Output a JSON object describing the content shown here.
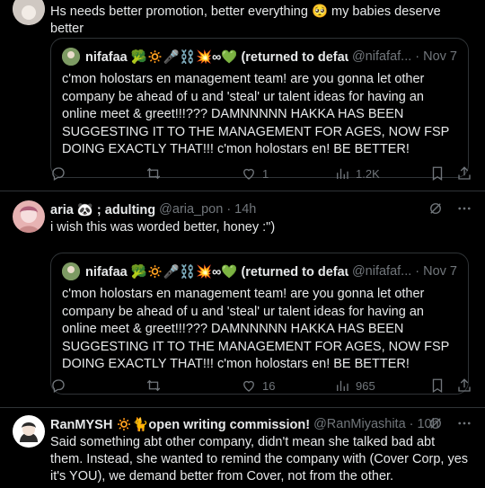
{
  "tweet1": {
    "text": "Hs needs better promotion, better everything 🥺 my babies deserve better",
    "quote": {
      "name": "nifafaa 🥦🔅🎤⛓️💥∞💚 (returned to defau...",
      "handle": "@nifafaf...",
      "dot": "·",
      "time": "Nov 7",
      "text": "c'mon holostars en management team! are you gonna let other company be ahead of u and 'steal' ur talent ideas for having an online meet & greet!!!??? DAMNNNNN HAKKA HAS BEEN SUGGESTING IT TO THE MANAGEMENT FOR AGES, NOW FSP DOING EXACTLY THAT!!! c'mon holostars en! BE BETTER!"
    },
    "actions": {
      "reply": "",
      "retweet": "",
      "like": "1",
      "views": "1.2K"
    }
  },
  "tweet2": {
    "name": "aria 🐼 ; adulting",
    "handle": "@aria_pon",
    "dot": "·",
    "time": "14h",
    "text": "i wish this was worded better, honey :\")",
    "quote": {
      "name": "nifafaa 🥦🔅🎤⛓️💥∞💚 (returned to defau...",
      "handle": "@nifafaf...",
      "dot": "·",
      "time": "Nov 7",
      "text": "c'mon holostars en management team! are you gonna let other company be ahead of u and 'steal' ur talent ideas for having an online meet & greet!!!??? DAMNNNNN HAKKA HAS BEEN SUGGESTING IT TO THE MANAGEMENT FOR AGES, NOW FSP DOING EXACTLY THAT!!! c'mon holostars en! BE BETTER!"
    },
    "actions": {
      "reply": "",
      "retweet": "",
      "like": "16",
      "views": "965"
    }
  },
  "tweet3": {
    "name": "RanMYSH 🔅🐈open writing commission!",
    "handle": "@RanMiyashita",
    "dot": "·",
    "time": "10h",
    "text": "Said something abt other company, didn't mean she talked bad abt them. Instead, she wanted to remind the company with (Cover Corp, yes it's YOU), we demand better from Cover, not from the other."
  },
  "colors": {
    "background": "#000000",
    "text": "#e7e9ea",
    "muted": "#71767b",
    "border": "#2f3336"
  },
  "icons": [
    "reply-icon",
    "retweet-icon",
    "like-icon",
    "views-icon",
    "bookmark-icon",
    "share-icon",
    "grok-icon",
    "more-icon"
  ]
}
